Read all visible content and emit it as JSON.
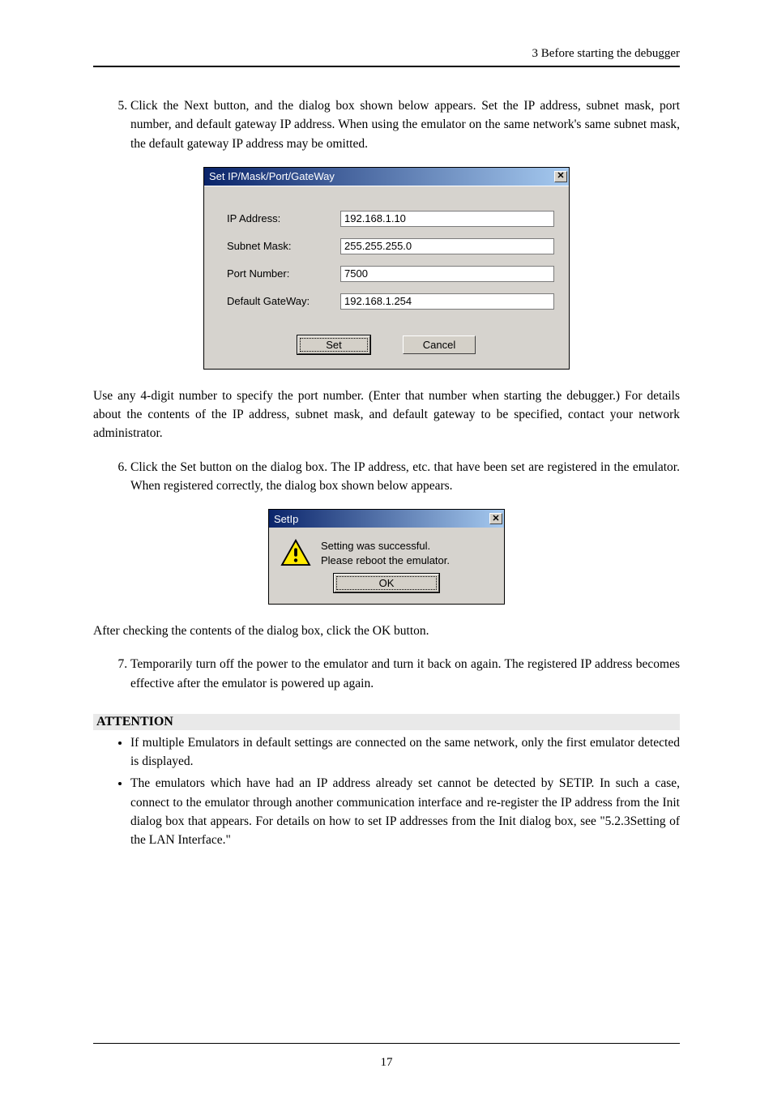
{
  "header": {
    "section": "3 Before starting the debugger"
  },
  "list": {
    "start": 5,
    "items": [
      "Click the Next button, and the dialog box shown below appears. Set the IP address, subnet mask, port number, and default gateway IP address. When using the emulator on the same network's same subnet mask, the default gateway IP address may be omitted.",
      "Click the Set button on the dialog box. The IP address, etc. that have been set are registered in the emulator. When registered correctly, the dialog box shown below appears.",
      "Temporarily turn off the power to the emulator and turn it back on again. The registered IP address becomes effective after the emulator is powered up again."
    ]
  },
  "inter": {
    "after5": "Use any 4-digit number to specify the port number. (Enter that number when starting the debugger.) For details about the contents of the IP address, subnet mask, and default gateway to be specified, contact your network administrator.",
    "after6": "After checking the contents of the dialog box, click the OK button."
  },
  "dlg1": {
    "title": "Set IP/Mask/Port/GateWay",
    "labels": {
      "ip": "IP Address:",
      "mask": "Subnet Mask:",
      "port": "Port Number:",
      "gw": "Default GateWay:"
    },
    "values": {
      "ip": "192.168.1.10",
      "mask": "255.255.255.0",
      "port": "7500",
      "gw": "192.168.1.254"
    },
    "buttons": {
      "set": "Set",
      "cancel": "Cancel"
    }
  },
  "dlg2": {
    "title": "SetIp",
    "message_l1": "Setting was successful.",
    "message_l2": "Please reboot the emulator.",
    "ok": "OK"
  },
  "attention": {
    "title": "ATTENTION",
    "bullets": [
      "If multiple Emulators in default settings are connected on the same network, only the first emulator detected is displayed.",
      "The emulators which have had an IP address already set cannot be detected by SETIP. In such a case, connect to the emulator through another communication interface and re-register the IP address from the Init dialog box that appears. For details on how to set IP addresses from the Init dialog box, see \"5.2.3Setting of the LAN Interface.\""
    ]
  },
  "page_number": "17"
}
